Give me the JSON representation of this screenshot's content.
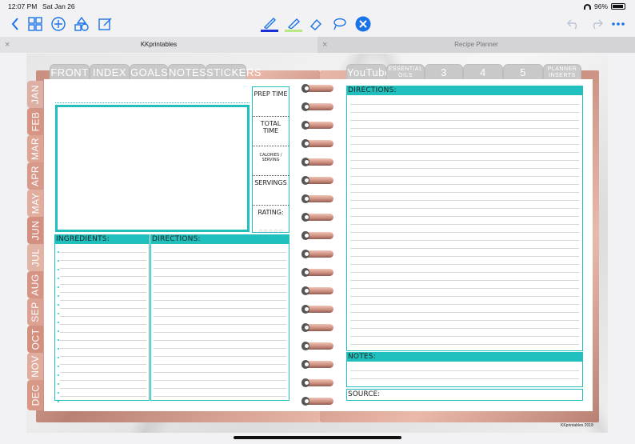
{
  "status": {
    "time": "12:07 PM",
    "date": "Sat Jan 26",
    "battery": "96%"
  },
  "toolbar": {
    "icons": [
      "back-icon",
      "grid-icon",
      "add-icon",
      "shapes-icon",
      "edit-icon",
      "pen-icon",
      "highlighter-icon",
      "eraser-icon",
      "lasso-icon",
      "close-icon",
      "undo-icon",
      "redo-icon",
      "more-icon"
    ],
    "pen_color": "#1b2fd6",
    "highlighter_color": "#b8e986",
    "accent": "#1a73e8"
  },
  "tabs": [
    {
      "label": "KKprintables"
    },
    {
      "label": "Recipe Planner"
    }
  ],
  "top_tabs_left": [
    "FRONT",
    "INDEX",
    "GOALS",
    "NOTES",
    "STICKERS"
  ],
  "top_tabs_right": [
    "YouTube",
    "ESSENTIAL OILS",
    "3",
    "4",
    "5",
    "PLANNER INSERTS"
  ],
  "side_tabs": [
    "JAN",
    "FEB",
    "MAR",
    "APR",
    "MAY",
    "JUN",
    "JUL",
    "AUG",
    "SEP",
    "OCT",
    "NOV",
    "DEC"
  ],
  "left_page": {
    "info": [
      "PREP TIME",
      "TOTAL TIME",
      "CALORIES / SERVING",
      "SERVINGS",
      "RATING:"
    ],
    "stars": "☆☆☆☆☆",
    "ingredients_label": "INGREDIENTS:",
    "directions_label": "DIRECTIONS:"
  },
  "right_page": {
    "directions_label": "DIRECTIONS:",
    "notes_label": "NOTES:",
    "source_label": "SOURCE:"
  },
  "brand": "KKprintables 2018",
  "colors": {
    "teal": "#1fc0be",
    "rose_gold": "#d9a293",
    "tab_gray": "#c9c9c9"
  }
}
